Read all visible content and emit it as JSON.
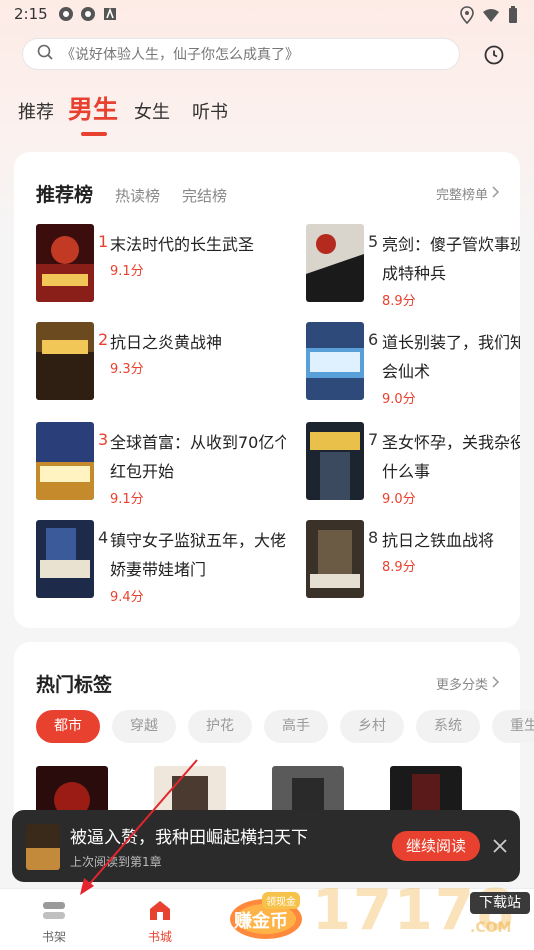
{
  "status_bar": {
    "time": "2:15"
  },
  "search": {
    "placeholder": "《说好体验人生，仙子你怎么成真了》"
  },
  "channel_tabs": [
    {
      "label": "推荐",
      "active": false
    },
    {
      "label": "男生",
      "active": true
    },
    {
      "label": "女生",
      "active": false
    },
    {
      "label": "听书",
      "active": false
    }
  ],
  "ranking": {
    "title": "推荐榜",
    "tabs": [
      "热读榜",
      "完结榜"
    ],
    "more": "完整榜单",
    "books": [
      {
        "rank": "1",
        "title": "末法时代的长生武圣",
        "title2": "",
        "score": "9.1分"
      },
      {
        "rank": "2",
        "title": "抗日之炎黄战神",
        "title2": "",
        "score": "9.3分"
      },
      {
        "rank": "3",
        "title": "全球首富：从收到70亿个",
        "title2": "红包开始",
        "score": "9.1分"
      },
      {
        "rank": "4",
        "title": "镇守女子监狱五年，大佬",
        "title2": "娇妻带娃堵门",
        "score": "9.4分"
      },
      {
        "rank": "5",
        "title": "亮剑：傻子管炊事班",
        "title2": "成特种兵",
        "score": "8.9分"
      },
      {
        "rank": "6",
        "title": "道长别装了，我们知",
        "title2": "会仙术",
        "score": "9.0分"
      },
      {
        "rank": "7",
        "title": "圣女怀孕，关我杂役",
        "title2": "什么事",
        "score": "9.0分"
      },
      {
        "rank": "8",
        "title": "抗日之铁血战将",
        "title2": "",
        "score": "8.9分"
      }
    ]
  },
  "tags": {
    "title": "热门标签",
    "more": "更多分类",
    "chips": [
      {
        "label": "都市",
        "active": true
      },
      {
        "label": "穿越",
        "active": false
      },
      {
        "label": "护花",
        "active": false
      },
      {
        "label": "高手",
        "active": false
      },
      {
        "label": "乡村",
        "active": false
      },
      {
        "label": "系统",
        "active": false
      },
      {
        "label": "重生",
        "active": false
      }
    ]
  },
  "continue_reading": {
    "title": "被逼入赘，我种田崛起横扫天下",
    "subtitle": "上次阅读到第1章",
    "button": "继续阅读"
  },
  "bottom_nav": {
    "bookshelf": "书架",
    "bookstore": "书城",
    "earn": "赚金币",
    "earn_tag": "领现金"
  },
  "watermark": {
    "site": "下载站",
    "num": "17178",
    "com": ".COM"
  },
  "colors": {
    "accent": "#e8412f",
    "dark_bar": "#2b2b2b"
  }
}
